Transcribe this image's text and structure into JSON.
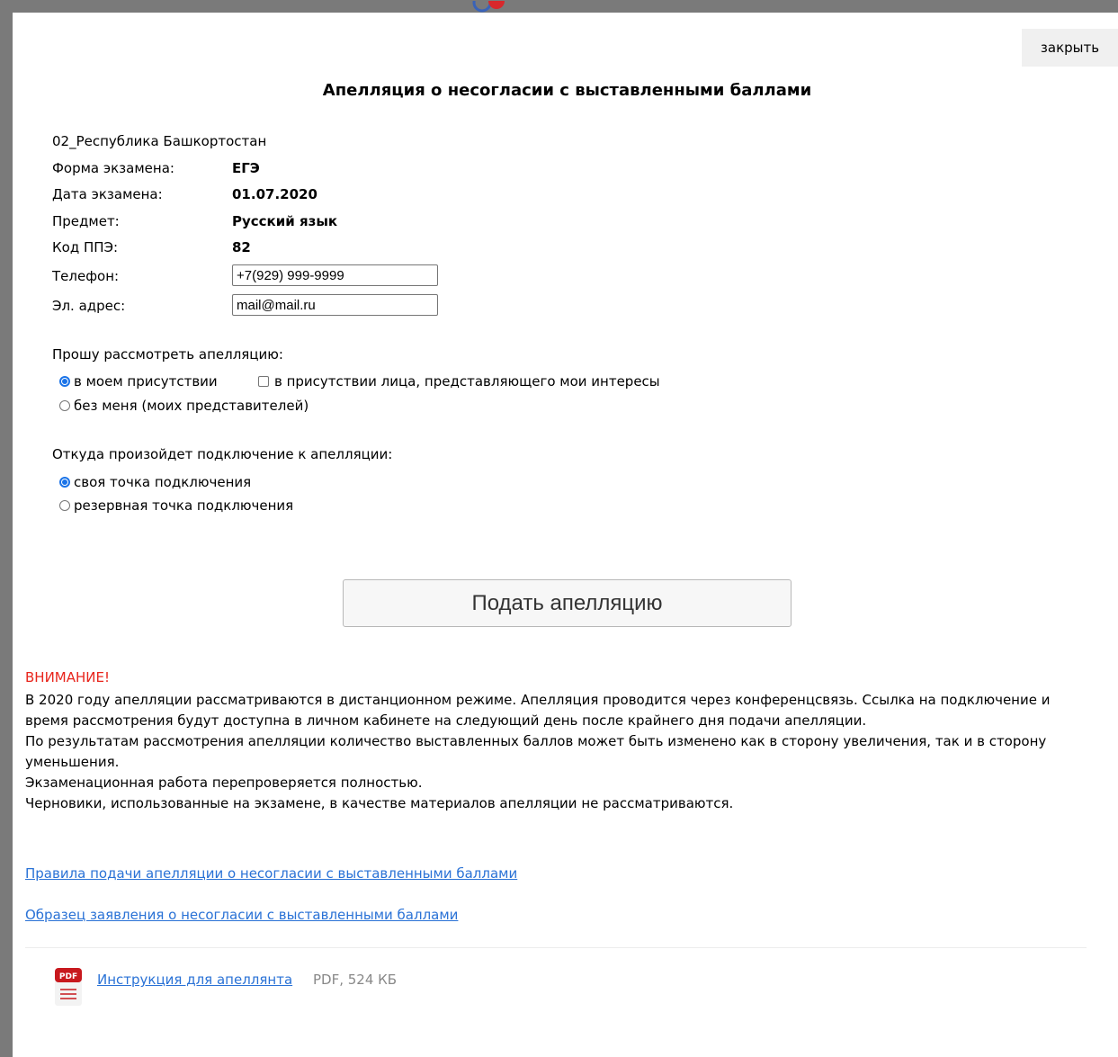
{
  "dialog": {
    "close_label": "закрыть",
    "title": "Апелляция о несогласии с выставленными баллами"
  },
  "info": {
    "region": "02_Республика Башкортостан",
    "fields": [
      {
        "label": "Форма экзамена:",
        "value": "ЕГЭ"
      },
      {
        "label": "Дата экзамена:",
        "value": "01.07.2020"
      },
      {
        "label": "Предмет:",
        "value": "Русский язык"
      },
      {
        "label": "Код ППЭ:",
        "value": "82"
      }
    ],
    "phone": {
      "label": "Телефон:",
      "value": "+7(929) 999-9999"
    },
    "email": {
      "label": "Эл. адрес:",
      "value": "mail@mail.ru"
    }
  },
  "review_options": {
    "label": "Прошу рассмотреть апелляцию:",
    "in_presence": "в моем присутствии",
    "representative": "в присутствии лица, представляющего мои интересы",
    "without_me": "без меня (моих представителей)"
  },
  "connection_options": {
    "label": "Откуда произойдет подключение к апелляции:",
    "own_point": "своя точка подключения",
    "backup_point": "резервная точка подключения"
  },
  "submit_label": "Подать апелляцию",
  "warning": {
    "title": "ВНИМАНИЕ!",
    "paragraphs": [
      "В 2020 году апелляции рассматриваются в дистанционном режиме. Апелляция проводится через конференцсвязь. Ссылка на подключение и время рассмотрения будут доступна в личном кабинете на следующий день после крайнего дня подачи апелляции.",
      "По результатам рассмотрения апелляции количество выставленных баллов может быть изменено как в сторону увеличения, так и в сторону уменьшения.",
      "Экзаменационная работа перепроверяется полностью.",
      "Черновики, использованные на экзамене, в качестве материалов апелляции не рассматриваются."
    ]
  },
  "links": {
    "rules": "Правила подачи апелляции о несогласии с выставленными баллами",
    "sample": "Образец заявления о несогласии с выставленными баллами"
  },
  "document": {
    "icon_text": "PDF",
    "link": "Инструкция для апеллянта",
    "meta": "PDF, 524 КБ"
  },
  "colors": {
    "warning": "#e8251c",
    "link": "#2a72d6",
    "radio_checked": "#1a73e8",
    "pdf_red": "#c8191e"
  }
}
